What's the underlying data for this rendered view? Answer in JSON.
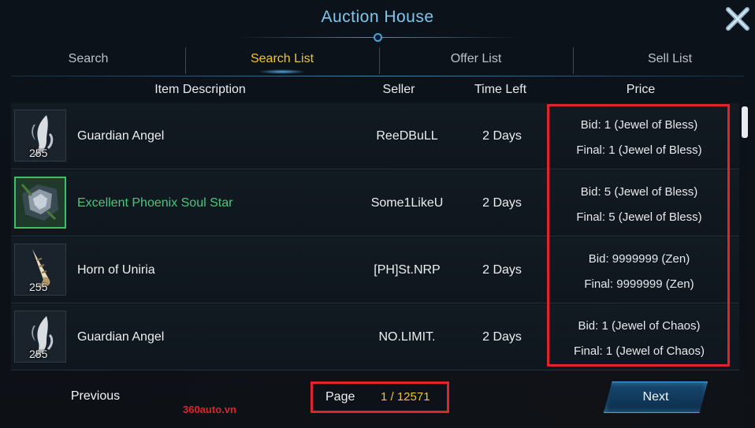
{
  "window": {
    "title": "Auction House"
  },
  "tabs": [
    {
      "label": "Search",
      "active": false
    },
    {
      "label": "Search List",
      "active": true
    },
    {
      "label": "Offer List",
      "active": false
    },
    {
      "label": "Sell List",
      "active": false
    }
  ],
  "columns": {
    "item": "Item Description",
    "seller": "Seller",
    "time": "Time Left",
    "price": "Price"
  },
  "rows": [
    {
      "icon": "angel-wings-icon",
      "qty": "255",
      "name": "Guardian Angel",
      "excellent": false,
      "seller": "ReeDBuLL",
      "time": "2 Days",
      "bid": "Bid: 1 (Jewel of Bless)",
      "final": "Final: 1 (Jewel of Bless)"
    },
    {
      "icon": "phoenix-soul-star-icon",
      "qty": "",
      "name": "Excellent Phoenix Soul Star",
      "excellent": true,
      "seller": "Some1LikeU",
      "time": "2 Days",
      "bid": "Bid: 5 (Jewel of Bless)",
      "final": "Final: 5 (Jewel of Bless)"
    },
    {
      "icon": "horn-icon",
      "qty": "255",
      "name": "Horn of Uniria",
      "excellent": false,
      "seller": "[PH]St.NRP",
      "time": "2 Days",
      "bid": "Bid: 9999999 (Zen)",
      "final": "Final: 9999999 (Zen)"
    },
    {
      "icon": "angel-wings-icon",
      "qty": "255",
      "name": "Guardian Angel",
      "excellent": false,
      "seller": "NO.LIMIT.",
      "time": "2 Days",
      "bid": "Bid: 1 (Jewel of Chaos)",
      "final": "Final: 1 (Jewel of Chaos)"
    }
  ],
  "pagination": {
    "previous_label": "Previous",
    "next_label": "Next",
    "page_label": "Page",
    "page_value": "1 / 12571"
  },
  "watermark": "360auto.vn",
  "colors": {
    "title": "#7cc7ee",
    "active_tab": "#f0c23a",
    "excellent_item": "#49c77d",
    "highlight": "#e0242c"
  }
}
